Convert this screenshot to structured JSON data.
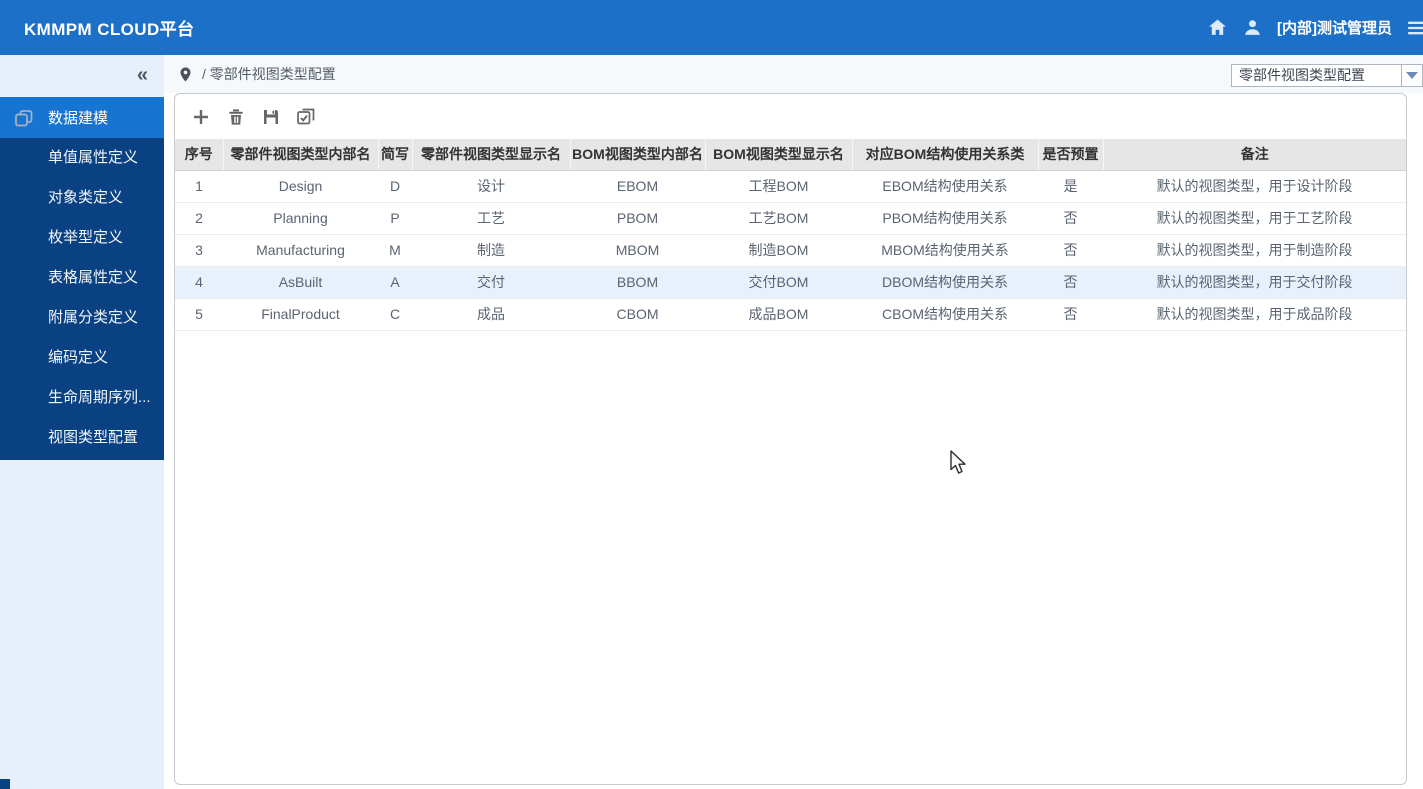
{
  "colors": {
    "header_bg": "#1c70c7",
    "sidebar_menu_bg": "#0a4183",
    "active_item_bg": "#1774d1",
    "sidebar_light_bg": "#e7f0fa",
    "table_header_bg": "#e6e6e6",
    "row_highlight_bg": "#e7f0fb"
  },
  "header": {
    "title": "KMMPM CLOUD平台",
    "user_name": "[内部]测试管理员",
    "icons": [
      "home-icon",
      "user-icon",
      "menu-icon"
    ]
  },
  "sidebar": {
    "collapse_icon": "«",
    "group": {
      "label": "数据建模",
      "icon": "layers-icon",
      "active": true
    },
    "items": [
      "单值属性定义",
      "对象类定义",
      "枚举型定义",
      "表格属性定义",
      "附属分类定义",
      "编码定义",
      "生命周期序列...",
      "视图类型配置"
    ]
  },
  "breadcrumb": {
    "icon": "location-pin-icon",
    "path": "/ 零部件视图类型配置"
  },
  "page_selector": {
    "value": "零部件视图类型配置",
    "icon": "dropdown-arrow-icon"
  },
  "toolbar": {
    "buttons": [
      {
        "name": "add-button",
        "icon": "plus-icon"
      },
      {
        "name": "delete-button",
        "icon": "trash-icon"
      },
      {
        "name": "save-button",
        "icon": "save-icon"
      },
      {
        "name": "batch-select-button",
        "icon": "checked-copy-icon"
      }
    ]
  },
  "table": {
    "columns": [
      "序号",
      "零部件视图类型内部名",
      "简写",
      "零部件视图类型显示名",
      "BOM视图类型内部名",
      "BOM视图类型显示名",
      "对应BOM结构使用关系类",
      "是否预置",
      "备注"
    ],
    "rows": [
      [
        "1",
        "Design",
        "D",
        "设计",
        "EBOM",
        "工程BOM",
        "EBOM结构使用关系",
        "是",
        "默认的视图类型，用于设计阶段"
      ],
      [
        "2",
        "Planning",
        "P",
        "工艺",
        "PBOM",
        "工艺BOM",
        "PBOM结构使用关系",
        "否",
        "默认的视图类型，用于工艺阶段"
      ],
      [
        "3",
        "Manufacturing",
        "M",
        "制造",
        "MBOM",
        "制造BOM",
        "MBOM结构使用关系",
        "否",
        "默认的视图类型，用于制造阶段"
      ],
      [
        "4",
        "AsBuilt",
        "A",
        "交付",
        "BBOM",
        "交付BOM",
        "DBOM结构使用关系",
        "否",
        "默认的视图类型，用于交付阶段"
      ],
      [
        "5",
        "FinalProduct",
        "C",
        "成品",
        "CBOM",
        "成品BOM",
        "CBOM结构使用关系",
        "否",
        "默认的视图类型，用于成品阶段"
      ]
    ],
    "highlighted_row_index": 3
  }
}
